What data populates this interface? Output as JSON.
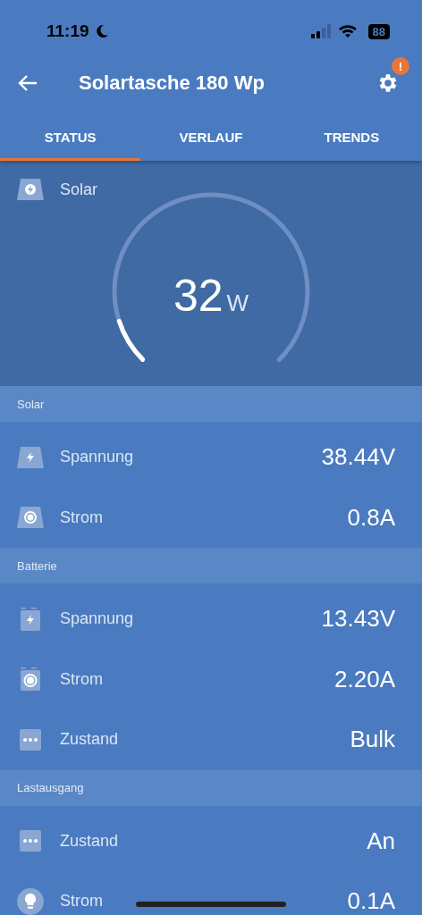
{
  "status_bar": {
    "time": "11:19",
    "battery": "88"
  },
  "header": {
    "title": "Solartasche 180 Wp",
    "settings_alert": "!"
  },
  "tabs": [
    {
      "label": "STATUS",
      "selected": true
    },
    {
      "label": "VERLAUF",
      "selected": false
    },
    {
      "label": "TRENDS",
      "selected": false
    }
  ],
  "gauge": {
    "label": "Solar",
    "value": "32",
    "unit": "W"
  },
  "sections": [
    {
      "title": "Solar",
      "rows": [
        {
          "kind": "panelvoltage",
          "label": "Spannung",
          "value": "38.44V"
        },
        {
          "kind": "panelcurrent",
          "label": "Strom",
          "value": "0.8A"
        }
      ]
    },
    {
      "title": "Batterie",
      "rows": [
        {
          "kind": "batteryvoltage",
          "label": "Spannung",
          "value": "13.43V"
        },
        {
          "kind": "batterycurrent",
          "label": "Strom",
          "value": "2.20A"
        },
        {
          "kind": "state",
          "label": "Zustand",
          "value": "Bulk"
        }
      ]
    },
    {
      "title": "Lastausgang",
      "rows": [
        {
          "kind": "state",
          "label": "Zustand",
          "value": "An"
        },
        {
          "kind": "load",
          "label": "Strom",
          "value": "0.1A"
        }
      ]
    }
  ]
}
